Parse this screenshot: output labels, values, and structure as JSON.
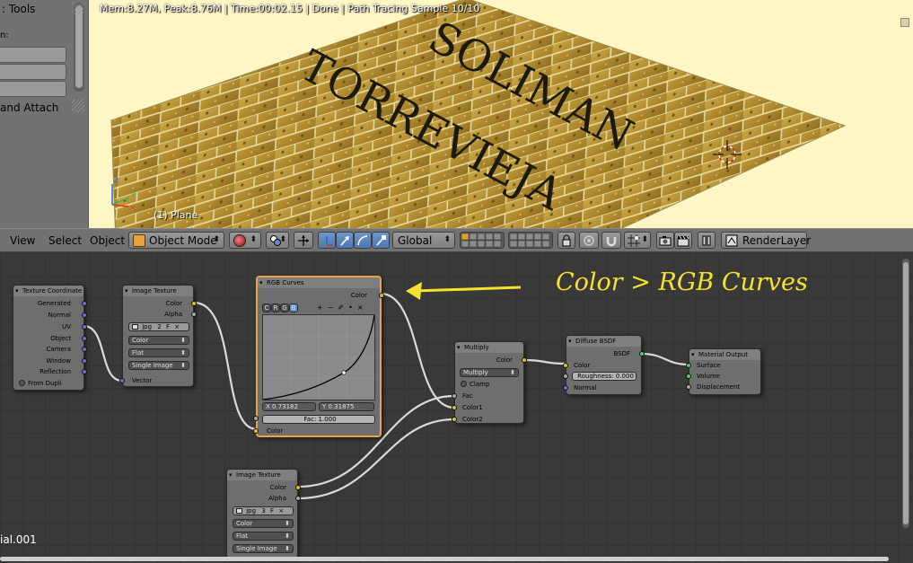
{
  "toolshelf": {
    "title": ": Tools",
    "label": "n:",
    "attach": "and Attach"
  },
  "viewport": {
    "render_info": "Mem:8.27M, Peak:8.76M | Time:00:02.15 | Done | Path Tracing Sample 10/10",
    "text_line1": "SOLIMAN",
    "text_line2": "TORREVIEJA",
    "object_label": "(1) Plane",
    "axes": {
      "x": "x",
      "y": "y",
      "z": "z"
    }
  },
  "header3d": {
    "menu": [
      "View",
      "Select",
      "Object"
    ],
    "mode": "Object Mode",
    "orientation": "Global",
    "render_layer": "RenderLayer"
  },
  "annotation": "Color > RGB Curves",
  "nodes": {
    "texcoord": {
      "title": "Texture Coordinate",
      "outputs": [
        "Generated",
        "Normal",
        "UV",
        "Object",
        "Camera",
        "Window",
        "Reflection"
      ],
      "from_dupli": "From Dupli"
    },
    "imgtex1": {
      "title": "Image Texture",
      "outputs": [
        "Color",
        "Alpha"
      ],
      "image": "jpg",
      "users": "2",
      "f": "F",
      "color_space": "Color",
      "projection": "Flat",
      "source": "Single Image",
      "input": "Vector"
    },
    "rgbcurves": {
      "title": "RGB Curves",
      "output": "Color",
      "channels": [
        "C",
        "R",
        "G",
        "B"
      ],
      "tools": [
        "+",
        "−",
        "✐",
        "•",
        "×"
      ],
      "x": "X 0.73182",
      "y": "Y 0.31875",
      "fac": "Fac: 1.000",
      "input": "Color"
    },
    "multiply": {
      "title": "Multiply",
      "output": "Color",
      "blend": "Multiply",
      "clamp": "Clamp",
      "inputs": [
        "Fac",
        "Color1",
        "Color2"
      ]
    },
    "diffuse": {
      "title": "Diffuse BSDF",
      "output": "BSDF",
      "inputs": [
        "Color",
        "Normal"
      ],
      "roughness": "Roughness: 0.000"
    },
    "output": {
      "title": "Material Output",
      "inputs": [
        "Surface",
        "Volume",
        "Displacement"
      ]
    },
    "imgtex2": {
      "title": "Image Texture",
      "outputs": [
        "Color",
        "Alpha"
      ],
      "image": "jpg",
      "users": "3",
      "f": "F",
      "color_space": "Color",
      "projection": "Flat",
      "source": "Single Image"
    }
  },
  "material_name": "ial.001",
  "colors": {
    "viewport_bg": "#fff6c6",
    "annotation": "#f5e12e",
    "active_node": "#e8a24a",
    "socket_color": "#cfc62d",
    "socket_vector": "#6c6cd0",
    "socket_shader": "#4ad06a"
  }
}
